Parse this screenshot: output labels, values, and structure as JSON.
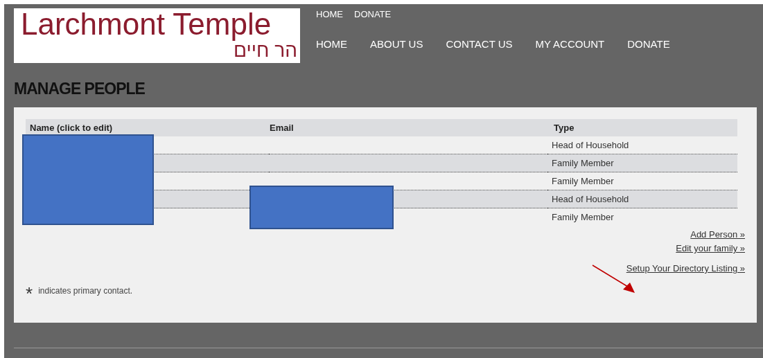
{
  "logo": {
    "name": "Larchmont Temple",
    "hebrew": "הר חיים"
  },
  "top_nav": [
    "HOME",
    "DONATE"
  ],
  "main_nav": [
    "HOME",
    "ABOUT US",
    "CONTACT US",
    "MY ACCOUNT",
    "DONATE"
  ],
  "page_title": "MANAGE PEOPLE",
  "table": {
    "columns": [
      "Name (click to edit)",
      "Email",
      "Type"
    ],
    "rows": [
      {
        "type": "Head of Household"
      },
      {
        "type": "Family Member"
      },
      {
        "type": "Family Member"
      },
      {
        "type": "Head of Household"
      },
      {
        "type": "Family Member"
      }
    ]
  },
  "links": [
    "Add Person »",
    "Edit your family »",
    "Setup Your Directory Listing »"
  ],
  "footnote": {
    "symbol": "*",
    "text": "indicates primary contact."
  }
}
